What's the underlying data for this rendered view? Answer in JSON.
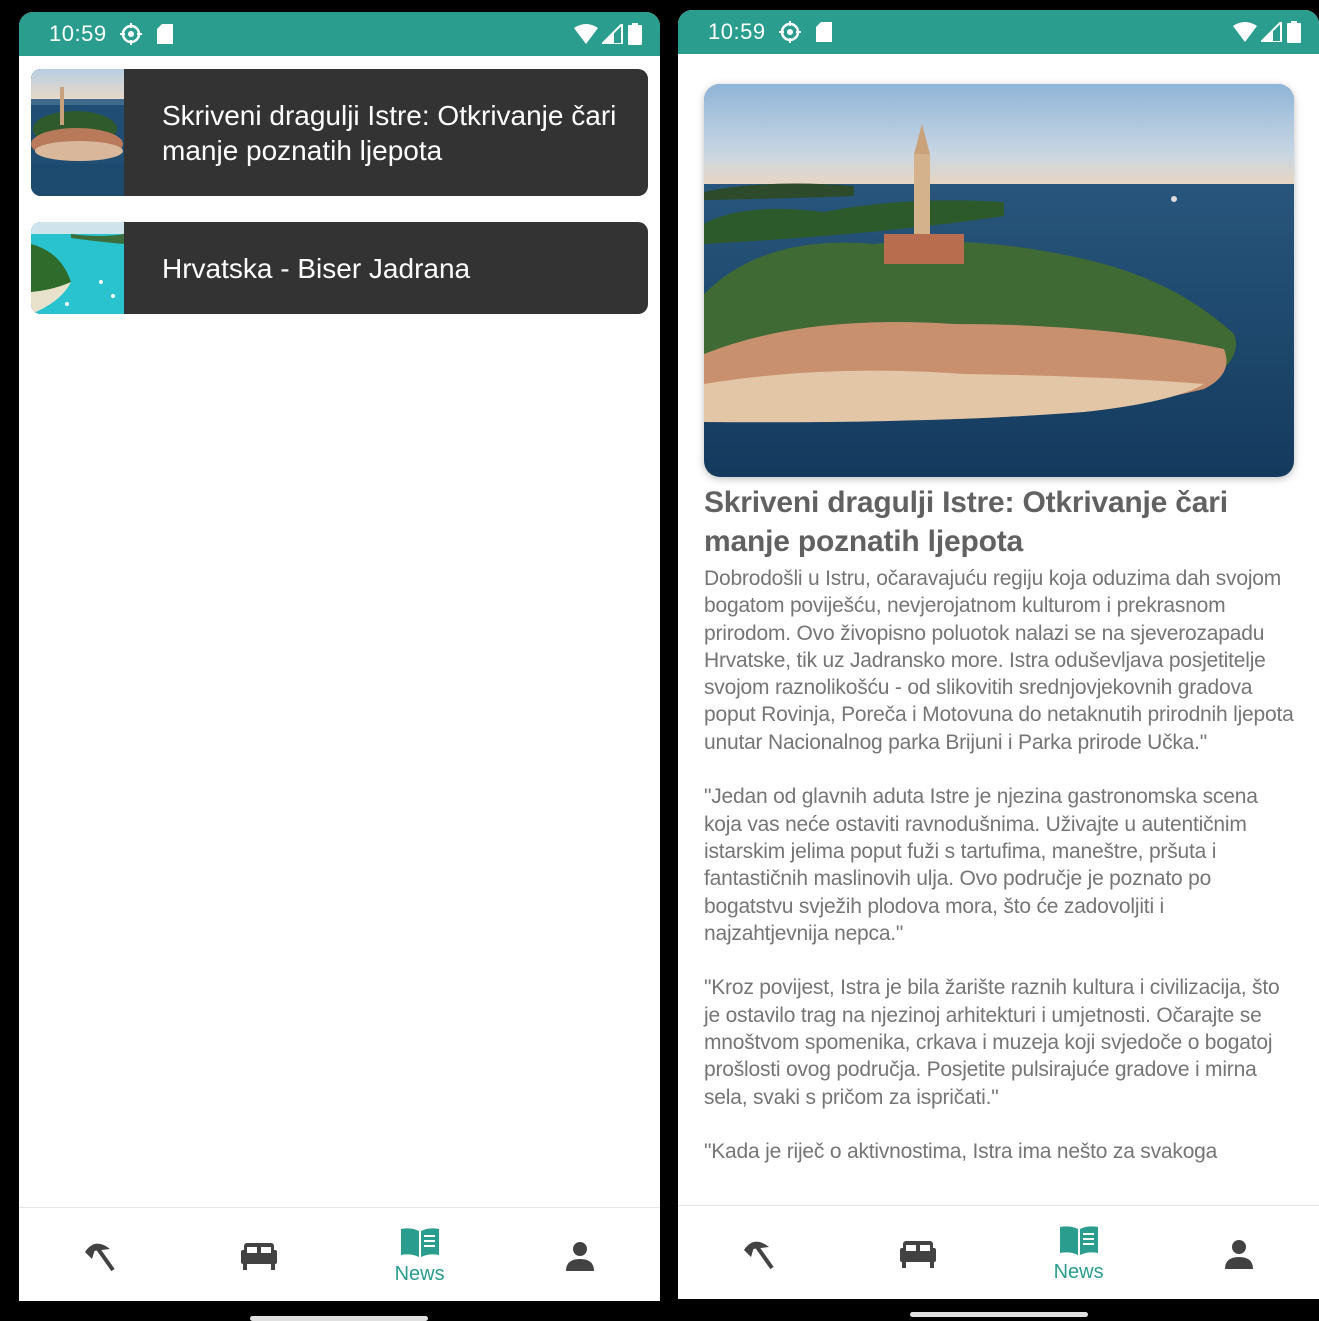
{
  "status_bar": {
    "time": "10:59",
    "color": "#2a9d8f"
  },
  "list_screen": {
    "items": [
      {
        "title": "Skriveni dragulji Istre: Otkrivanje čari manje poznatih ljepota",
        "thumbnail": "rovinj-aerial-thumbnail"
      },
      {
        "title": "Hrvatska - Biser Jadrana",
        "thumbnail": "beach-coast-thumbnail"
      }
    ]
  },
  "detail_screen": {
    "title": "Skriveni dragulji Istre: Otkrivanje čari manje poznatih ljepota",
    "body": "Dobrodošli u Istru, očaravajuću regiju koja oduzima dah svojom bogatom poviješću, nevjerojatnom kulturom i prekrasnom prirodom. Ovo živopisno poluotok nalazi se na sjeverozapadu Hrvatske, tik uz Jadransko more. Istra oduševljava posjetitelje svojom raznolikošću - od slikovitih srednjovjekovnih gradova poput Rovinja, Poreča i Motovuna do netaknutih prirodnih ljepota unutar Nacionalnog parka Brijuni i Parka prirode Učka.\"\n\n\"Jedan od glavnih aduta Istre je njezina gastronomska scena koja vas neće ostaviti ravnodušnima. Uživajte u autentičnim istarskim jelima poput fuži s tartufima, maneštre, pršuta i fantastičnih maslinovih ulja. Ovo područje je poznato po bogatstvu svježih plodova mora, što će zadovoljiti i najzahtjevnija nepca.\"\n\n\"Kroz povijest, Istra je bila žarište raznih kultura i civilizacija, što je ostavilo trag na njezinoj arhitekturi i umjetnosti. Očarajte se mnoštvom spomenika, crkava i muzeja koji svjedoče o bogatoj prošlosti ovog područja. Posjetite pulsirajuće gradove i mirna sela, svaki s pričom za ispričati.\"\n\n\"Kada je riječ o aktivnostima, Istra ima nešto za svakoga",
    "hero_image": "rovinj-aerial-photo"
  },
  "bottom_nav": {
    "items": [
      {
        "icon": "beach-umbrella-icon",
        "label": ""
      },
      {
        "icon": "bed-icon",
        "label": ""
      },
      {
        "icon": "book-icon",
        "label": "News",
        "active": true
      },
      {
        "icon": "person-icon",
        "label": ""
      }
    ],
    "active_color": "#2a9d8f",
    "inactive_color": "#424242"
  }
}
